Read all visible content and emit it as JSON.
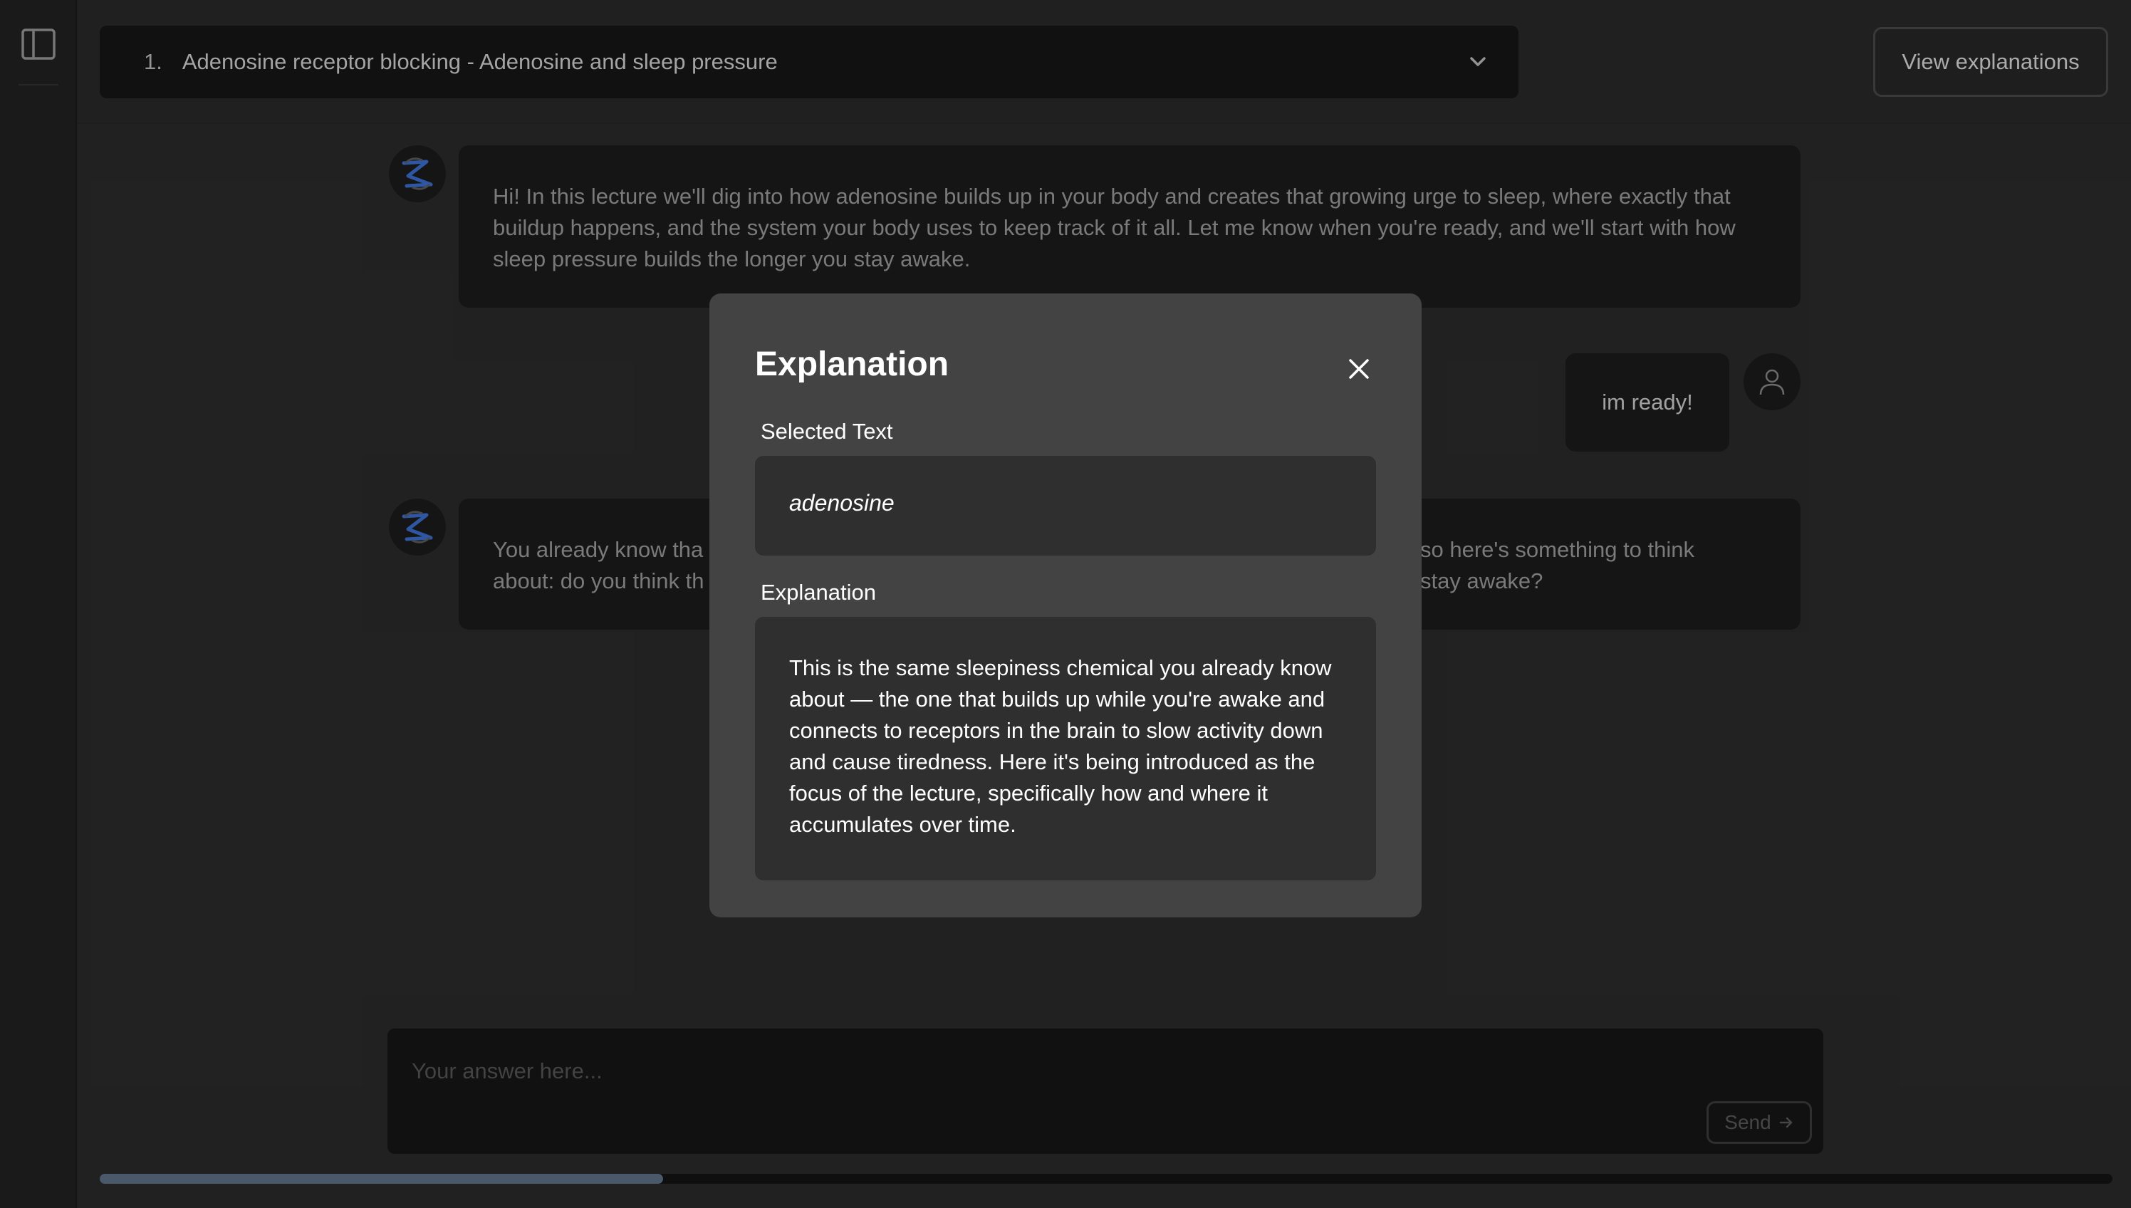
{
  "sidebar": {
    "toggle_icon": "sidebar-toggle-icon"
  },
  "header": {
    "topic_number": "1.",
    "topic_title": "Adenosine receptor blocking - Adenosine and sleep pressure",
    "view_explanations_label": "View explanations"
  },
  "chat": {
    "messages": [
      {
        "role": "assistant",
        "text": "Hi! In this lecture we'll dig into how adenosine builds up in your body and creates that growing urge to sleep, where exactly that buildup happens, and the system your body uses to keep track of it all. Let me know when you're ready, and we'll start with how sleep pressure builds the longer you stay awake."
      },
      {
        "role": "user",
        "text": "im ready!"
      },
      {
        "role": "assistant",
        "text_left_line1": "You already know tha",
        "text_left_line2": "about: do you think th",
        "text_right_line1": "so here's something to think",
        "text_right_line2": "stay awake?"
      }
    ]
  },
  "composer": {
    "placeholder": "Your answer here...",
    "send_label": "Send"
  },
  "modal": {
    "title": "Explanation",
    "selected_label": "Selected Text",
    "selected_text": "adenosine",
    "explanation_label": "Explanation",
    "explanation_text": "This is the same sleepiness chemical you already know about — the one that builds up while you're awake and connects to receptors in the brain to slow activity down and cause tiredness. Here it's being introduced as the focus of the lecture, specifically how and where it accumulates over time."
  },
  "colors": {
    "accent_blue": "#3b6fd1",
    "scroll_thumb": "#5e7388",
    "modal_bg": "#434343"
  }
}
